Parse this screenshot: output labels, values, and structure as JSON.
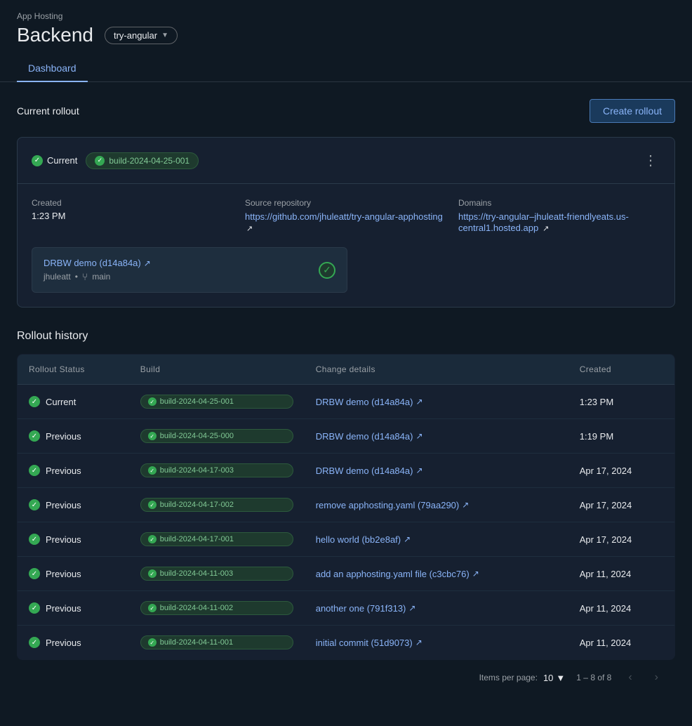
{
  "app": {
    "hosting_label": "App Hosting",
    "backend_title": "Backend"
  },
  "branch_selector": {
    "label": "try-angular"
  },
  "tabs": [
    {
      "id": "dashboard",
      "label": "Dashboard",
      "active": true
    }
  ],
  "current_rollout": {
    "section_title": "Current rollout",
    "create_button_label": "Create rollout",
    "status": "Current",
    "build_id": "build-2024-04-25-001",
    "created_label": "Created",
    "created_value": "1:23 PM",
    "source_repo_label": "Source repository",
    "source_repo_url": "https://github.com/jhuleatt/try-angular-apphosting",
    "domains_label": "Domains",
    "domains_url": "https://try-angular–jhuleatt-friendlyeats.us-central1.hosted.app",
    "commit_label": "DRBW demo (d14a84a)",
    "commit_url": "#",
    "commit_author": "jhuleatt",
    "commit_branch": "main",
    "more_options_label": "More options"
  },
  "rollout_history": {
    "title": "Rollout history",
    "table_headers": {
      "status": "Rollout Status",
      "build": "Build",
      "change": "Change details",
      "created": "Created"
    },
    "rows": [
      {
        "status": "Current",
        "build": "build-2024-04-25-001",
        "change": "DRBW demo (d14a84a)",
        "change_url": "#",
        "created": "1:23 PM"
      },
      {
        "status": "Previous",
        "build": "build-2024-04-25-000",
        "change": "DRBW demo (d14a84a)",
        "change_url": "#",
        "created": "1:19 PM"
      },
      {
        "status": "Previous",
        "build": "build-2024-04-17-003",
        "change": "DRBW demo (d14a84a)",
        "change_url": "#",
        "created": "Apr 17, 2024"
      },
      {
        "status": "Previous",
        "build": "build-2024-04-17-002",
        "change": "remove apphosting.yaml (79aa290)",
        "change_url": "#",
        "created": "Apr 17, 2024"
      },
      {
        "status": "Previous",
        "build": "build-2024-04-17-001",
        "change": "hello world (bb2e8af)",
        "change_url": "#",
        "created": "Apr 17, 2024"
      },
      {
        "status": "Previous",
        "build": "build-2024-04-11-003",
        "change": "add an apphosting.yaml file (c3cbc76)",
        "change_url": "#",
        "created": "Apr 11, 2024"
      },
      {
        "status": "Previous",
        "build": "build-2024-04-11-002",
        "change": "another one (791f313)",
        "change_url": "#",
        "created": "Apr 11, 2024"
      },
      {
        "status": "Previous",
        "build": "build-2024-04-11-001",
        "change": "initial commit (51d9073)",
        "change_url": "#",
        "created": "Apr 11, 2024"
      }
    ],
    "pagination": {
      "items_per_page_label": "Items per page:",
      "items_per_page_value": "10",
      "range": "1 – 8 of 8"
    }
  }
}
